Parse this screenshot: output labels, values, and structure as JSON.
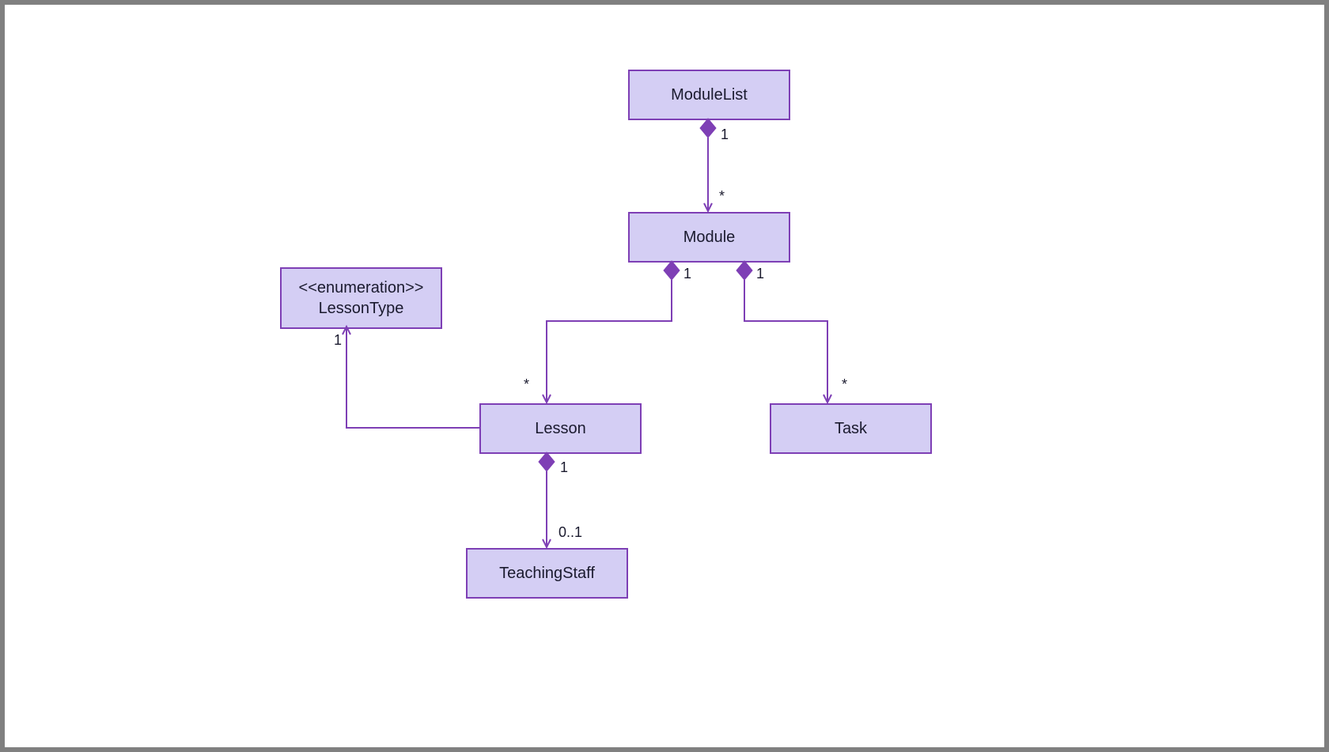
{
  "colors": {
    "boxFill": "#d4cef4",
    "boxStroke": "#7e3fb5",
    "line": "#7e3fb5",
    "text": "#1a1a2e"
  },
  "boxes": {
    "moduleList": {
      "label": "ModuleList"
    },
    "module": {
      "label": "Module"
    },
    "lessonType": {
      "stereotype": "<<enumeration>>",
      "label": "LessonType"
    },
    "lesson": {
      "label": "Lesson"
    },
    "task": {
      "label": "Task"
    },
    "teachingStaff": {
      "label": "TeachingStaff"
    }
  },
  "multiplicities": {
    "moduleList_module_top": "1",
    "moduleList_module_bot": "*",
    "module_lesson_top": "1",
    "module_lesson_bot": "*",
    "module_task_top": "1",
    "module_task_bot": "*",
    "lesson_teaching_top": "1",
    "lesson_teaching_bot": "0..1",
    "lesson_lessonType": "1"
  }
}
